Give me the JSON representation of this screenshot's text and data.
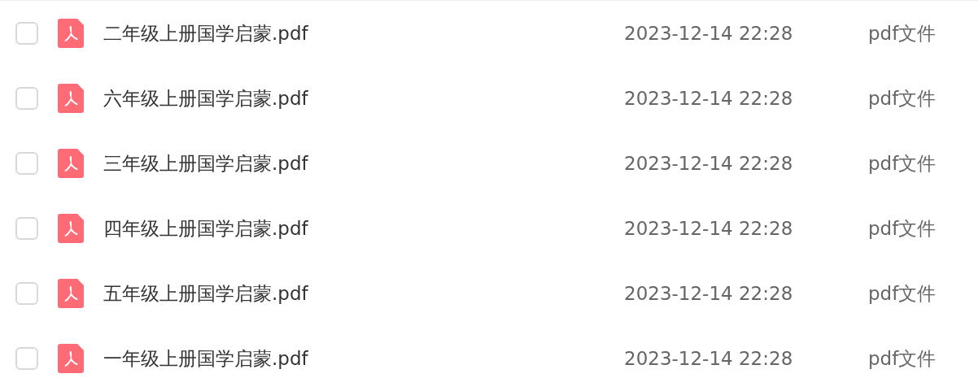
{
  "files": [
    {
      "name": "二年级上册国学启蒙.pdf",
      "date": "2023-12-14 22:28",
      "type": "pdf文件",
      "checked": false
    },
    {
      "name": "六年级上册国学启蒙.pdf",
      "date": "2023-12-14 22:28",
      "type": "pdf文件",
      "checked": false
    },
    {
      "name": "三年级上册国学启蒙.pdf",
      "date": "2023-12-14 22:28",
      "type": "pdf文件",
      "checked": false
    },
    {
      "name": "四年级上册国学启蒙.pdf",
      "date": "2023-12-14 22:28",
      "type": "pdf文件",
      "checked": false
    },
    {
      "name": "五年级上册国学启蒙.pdf",
      "date": "2023-12-14 22:28",
      "type": "pdf文件",
      "checked": false
    },
    {
      "name": "一年级上册国学启蒙.pdf",
      "date": "2023-12-14 22:28",
      "type": "pdf文件",
      "checked": false
    }
  ]
}
